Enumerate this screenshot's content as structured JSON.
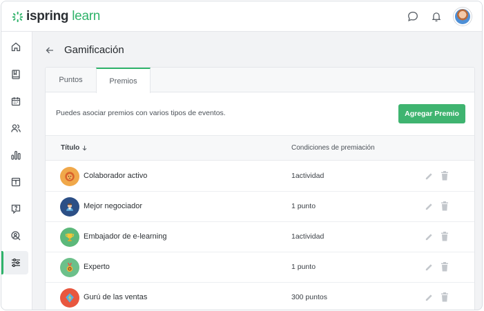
{
  "app": {
    "logo_word_1": "ispring",
    "logo_word_2": "learn",
    "brand_color": "#2fb36a",
    "icons": [
      "chat-icon",
      "bell-icon",
      "avatar"
    ]
  },
  "sidebar": {
    "items": [
      {
        "icon": "home-icon"
      },
      {
        "icon": "book-icon"
      },
      {
        "icon": "calendar-icon"
      },
      {
        "icon": "users-icon"
      },
      {
        "icon": "reports-icon"
      },
      {
        "icon": "info-icon"
      },
      {
        "icon": "help-icon"
      },
      {
        "icon": "search-user-icon"
      },
      {
        "icon": "settings-sliders-icon",
        "active": true
      }
    ]
  },
  "page": {
    "title": "Gamificación",
    "tabs": [
      "Puntos",
      "Premios"
    ],
    "active_tab": "Premios",
    "info_text": "Puedes asociar premios con varios tipos de eventos.",
    "add_button": "Agregar Premio"
  },
  "table": {
    "columns": {
      "title": "Título",
      "conditions": "Condiciones de premiación"
    },
    "rows": [
      {
        "name": "Colaborador activo",
        "condition": "1actividad",
        "badge": "lion-badge-icon",
        "badge_color": "#f0a84a"
      },
      {
        "name": "Mejor negociador",
        "condition": "1 punto",
        "badge": "negotiator-badge-icon",
        "badge_color": "#2c4f86"
      },
      {
        "name": "Embajador de e-learning",
        "condition": "1actividad",
        "badge": "trophy-badge-icon",
        "badge_color": "#5cb87a"
      },
      {
        "name": "Experto",
        "condition": "1 punto",
        "badge": "medal-badge-icon",
        "badge_color": "#6cc08a"
      },
      {
        "name": "Gurú de las ventas",
        "condition": "300 puntos",
        "badge": "lightning-badge-icon",
        "badge_color": "#e8573f"
      }
    ]
  }
}
